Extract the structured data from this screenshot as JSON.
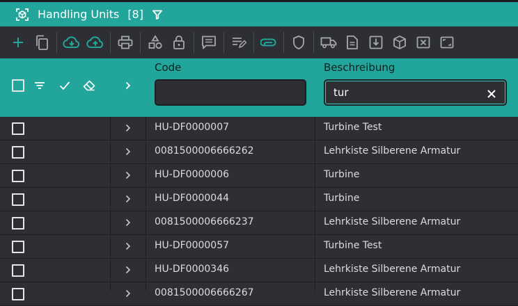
{
  "title": {
    "label": "Handling Units",
    "count": "[8]"
  },
  "colors": {
    "accent": "#22a59b",
    "background": "#2e2f33",
    "icon_teal": "#22a59b",
    "icon_grey": "#a6a8ad"
  },
  "toolbar": {
    "icons": [
      "plus-icon",
      "copy-icon",
      "cloud-download-icon",
      "cloud-upload-icon",
      "print-icon",
      "shapes-icon",
      "lock-icon",
      "comment-icon",
      "edit-list-icon",
      "attachment-icon",
      "shield-icon",
      "truck-icon",
      "document-icon",
      "download-box-icon",
      "package-icon",
      "close-box-icon",
      "expand-icon"
    ]
  },
  "columns": {
    "code": {
      "label": "Code",
      "value": "",
      "placeholder": ""
    },
    "description": {
      "label": "Beschreibung",
      "value": "tur",
      "placeholder": ""
    }
  },
  "rows": [
    {
      "code": "HU-DF0000007",
      "description": "Turbine Test"
    },
    {
      "code": "0081500006666262",
      "description": "Lehrkiste Silberene Armatur"
    },
    {
      "code": "HU-DF0000006",
      "description": "Turbine"
    },
    {
      "code": "HU-DF0000044",
      "description": "Turbine"
    },
    {
      "code": "0081500006666237",
      "description": "Lehrkiste Silberene Armatur"
    },
    {
      "code": "HU-DF0000057",
      "description": "Turbine Test"
    },
    {
      "code": "HU-DF0000346",
      "description": "Lehrkiste Silberene Armatur"
    },
    {
      "code": "0081500006666267",
      "description": "Lehrkiste Silberene Armatur"
    }
  ]
}
